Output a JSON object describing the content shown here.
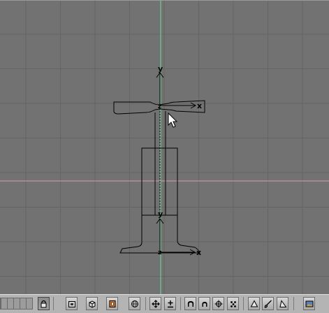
{
  "viewport": {
    "axis_labels": {
      "top_object_y": "y",
      "top_object_x": "x",
      "top_object_z": "z",
      "bottom_object_y": "y",
      "bottom_object_x": "x",
      "bottom_object_z": "z"
    },
    "colors": {
      "background": "#727272",
      "grid": "#646464",
      "y_axis": "#6fdc9e",
      "x_axis": "#d6a0a6",
      "outline": "#000000"
    }
  },
  "toolbar": {
    "buttons": [
      {
        "name": "view-layers-strip",
        "icon": "layers-grid-icon"
      },
      {
        "name": "lock-button",
        "icon": "lock-icon",
        "pressed": true
      },
      {
        "name": "draw-type-bounds-button",
        "icon": "bounding-box-icon"
      },
      {
        "name": "draw-type-solid-button",
        "icon": "solid-cube-icon"
      },
      {
        "name": "pivot-button",
        "icon": "pivot-icon"
      },
      {
        "name": "wire-sphere-button",
        "icon": "wire-sphere-icon"
      },
      {
        "name": "translate-manipulator-button",
        "icon": "translate-arrows-icon"
      },
      {
        "name": "scale-manipulator-button",
        "icon": "scale-icon"
      },
      {
        "name": "proportional-edit-button",
        "icon": "horseshoe-icon"
      },
      {
        "name": "proportional-falloff-button",
        "icon": "horseshoe-small-icon"
      },
      {
        "name": "snap-target-button",
        "icon": "crosshair-icon"
      },
      {
        "name": "snap-points-button",
        "icon": "dots-icon"
      },
      {
        "name": "triangle-tool-button",
        "icon": "triangle-icon"
      },
      {
        "name": "paint-button",
        "icon": "brush-icon"
      },
      {
        "name": "sculpt-button",
        "icon": "wedge-icon"
      },
      {
        "name": "render-view-button",
        "icon": "image-icon"
      }
    ]
  }
}
